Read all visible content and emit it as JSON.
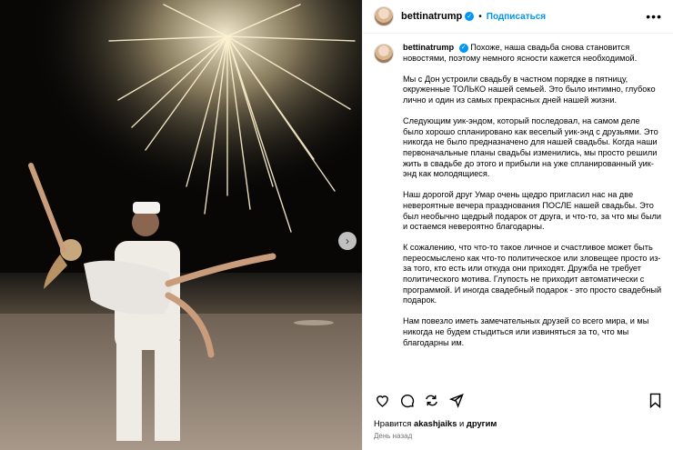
{
  "post": {
    "username": "bettinatrump",
    "follow_label": "Подписаться",
    "more_label": "•••",
    "verified_mark": "✓",
    "caption_paragraphs": [
      "Похоже, наша свадьба снова становится новостями, поэтому немного ясности кажется необходимой.",
      "Мы с Дон устроили свадьбу в частном порядке в пятницу, окруженные ТОЛЬКО нашей семьей. Это было интимно, глубоко лично и один из самых прекрасных дней нашей жизни.",
      "Следующим уик-эндом, который последовал, на самом деле было хорошо спланировано как веселый уик-энд с друзьями. Это никогда не было предназначено для нашей свадьбы. Когда наши первоначальные планы свадьбы изменились, мы просто решили жить в свадьбе до этого и прибыли на уже спланированный уик-энд как молодящиеся.",
      "Наш дорогой друг Умар очень щедро пригласил нас на две невероятные вечера празднования ПОСЛЕ нашей свадьбы. Это был необычно щедрый подарок от друга, и что-то, за что мы были и остаемся невероятно благодарны.",
      "К сожалению, что что-то такое личное и счастливое может быть переосмыслено как что-то политическое или зловещее просто из-за того, кто есть или откуда они приходят. Дружба не требует политического мотива. Глупость не приходит автоматически с программой. И иногда свадебный подарок - это просто свадебный подарок.",
      "Нам повезло иметь замечательных друзей со всего мира, и мы никогда не будем стыдиться или извиняться за то, что мы благодарны им."
    ],
    "likes_prefix": "Нравится",
    "likes_user": "akashjaiks",
    "likes_conj": "и",
    "likes_others": "другим",
    "timestamp": "День назад"
  },
  "photo": {
    "next_button_icon": "chevron-right-icon",
    "next_glyph": "›"
  },
  "icons": [
    "heart-icon",
    "comment-icon",
    "share-icon",
    "send-icon",
    "bookmark-icon"
  ],
  "colors": {
    "accent": "#0095f6",
    "muted": "#737373"
  }
}
